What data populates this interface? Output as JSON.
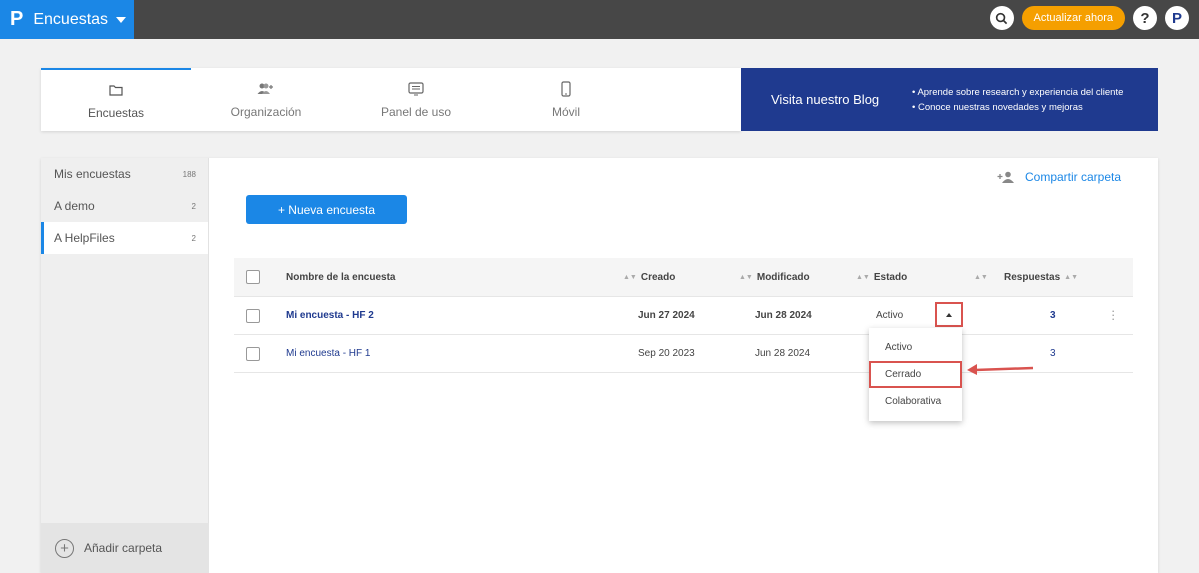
{
  "app": {
    "logo": "P",
    "name": "Encuestas"
  },
  "topbar": {
    "upgrade_label": "Actualizar ahora",
    "help": "?",
    "avatar": "P"
  },
  "tabs": [
    {
      "label": "Encuestas",
      "icon": "folder-icon"
    },
    {
      "label": "Organización",
      "icon": "users-add-icon"
    },
    {
      "label": "Panel de uso",
      "icon": "monitor-icon"
    },
    {
      "label": "Móvil",
      "icon": "mobile-icon"
    }
  ],
  "blog": {
    "title": "Visita nuestro Blog",
    "bullets": [
      "• Aprende sobre research y experiencia del cliente",
      "• Conoce nuestras novedades y mejoras"
    ]
  },
  "sidebar": {
    "items": [
      {
        "label": "Mis encuestas",
        "count": "188"
      },
      {
        "label": "A demo",
        "count": "2"
      },
      {
        "label": "A HelpFiles",
        "count": "2"
      }
    ],
    "add_label": "Añadir carpeta"
  },
  "share_label": "Compartir carpeta",
  "new_survey_label": "+ Nueva encuesta",
  "table": {
    "headers": {
      "name": "Nombre de la encuesta",
      "created": "Creado",
      "modified": "Modificado",
      "state": "Estado",
      "responses": "Respuestas"
    },
    "rows": [
      {
        "name": "Mi encuesta - HF 2",
        "created": "Jun 27 2024",
        "modified": "Jun 28 2024",
        "state": "Activo",
        "responses": "3"
      },
      {
        "name": "Mi encuesta - HF 1",
        "created": "Sep 20 2023",
        "modified": "Jun 28 2024",
        "state": "",
        "responses": "3"
      }
    ]
  },
  "dropdown": {
    "options": [
      "Activo",
      "Cerrado",
      "Colaborativa"
    ],
    "highlighted": "Cerrado"
  },
  "colors": {
    "brand": "#1b87e6",
    "navy": "#1f3a8f",
    "highlight": "#d9534f",
    "upgrade": "#f59f00"
  }
}
